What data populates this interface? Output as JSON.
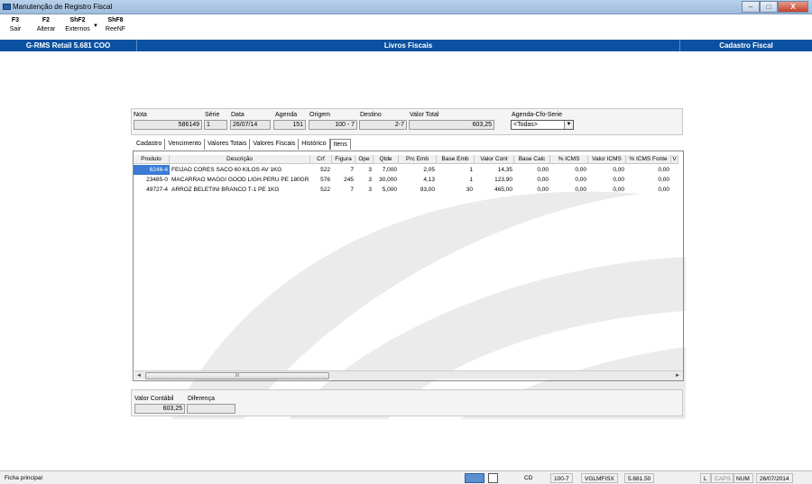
{
  "window": {
    "title": "Manutenção de Registro Fiscal",
    "buttons": [
      "–",
      "□",
      "X"
    ]
  },
  "toolbar": [
    {
      "key": "F3",
      "label": "Sair"
    },
    {
      "key": "F2",
      "label": "Alterar"
    },
    {
      "key": "ShF2",
      "label": "Externos"
    },
    {
      "key": "ShF8",
      "label": "ReeNF"
    }
  ],
  "bluebar": {
    "left": "G-RMS Retail 5.681 COO",
    "center": "Livros Fiscais",
    "right": "Cadastro Fiscal"
  },
  "header": {
    "nota_label": "Nota",
    "nota": "586149",
    "serie_label": "Série",
    "serie": "1",
    "data_label": "Data",
    "data": "26/07/14",
    "agenda_label": "Agenda",
    "agenda": "151",
    "origem_label": "Origem",
    "origem": "100 - 7",
    "destino_label": "Destino",
    "destino": "2-7",
    "valor_total_label": "Valor Total",
    "valor_total": "603,25",
    "agenda_cfo_label": "Agenda-Cfo-Serie",
    "agenda_cfo": "<Todas>"
  },
  "tabs": [
    "Cadastro",
    "Vencimento",
    "Valores Totais",
    "Valores Fiscais",
    "Histórico",
    "Itens"
  ],
  "grid": {
    "columns": [
      "Produto",
      "Descrição",
      "Crf",
      "Figura",
      "Ope",
      "Qtde",
      "Prc Emb",
      "Base Emb",
      "Valor Cont",
      "Base Calc",
      "% ICMS",
      "Valor ICMS",
      "% ICMS Fonte",
      "V"
    ],
    "rows": [
      [
        "6246-4",
        "FEIJAO CORES SACO 60 KILOS      AV 1KG",
        "522",
        "7",
        "3",
        "7,000",
        "2,05",
        "1",
        "14,35",
        "0,00",
        "0,00",
        "0,00",
        "0,00"
      ],
      [
        "23485-0",
        "MACARRAO MAGGI GOOD LIGH.PERU   PE 180GR",
        "576",
        "245",
        "3",
        "30,000",
        "4,13",
        "1",
        "123,90",
        "0,00",
        "0,00",
        "0,00",
        "0,00"
      ],
      [
        "49727-4",
        "ARROZ BELETINI BRANCO T-1      PE  1KG",
        "522",
        "7",
        "3",
        "5,000",
        "93,00",
        "30",
        "465,00",
        "0,00",
        "0,00",
        "0,00",
        "0,00"
      ]
    ],
    "scroll_thumb": "III"
  },
  "footer": {
    "valor_contabil_label": "Valor Contábil",
    "valor_contabil": "603,25",
    "diferenca_label": "Diferença",
    "diferenca": ""
  },
  "status": {
    "left": "Ficha principal",
    "cd": "CD",
    "origem": "100-7",
    "program": "VGLMFISX",
    "version": "5.681.50",
    "l": "L",
    "caps": "CAPS",
    "num": "NUM",
    "date": "26/07/2014"
  }
}
